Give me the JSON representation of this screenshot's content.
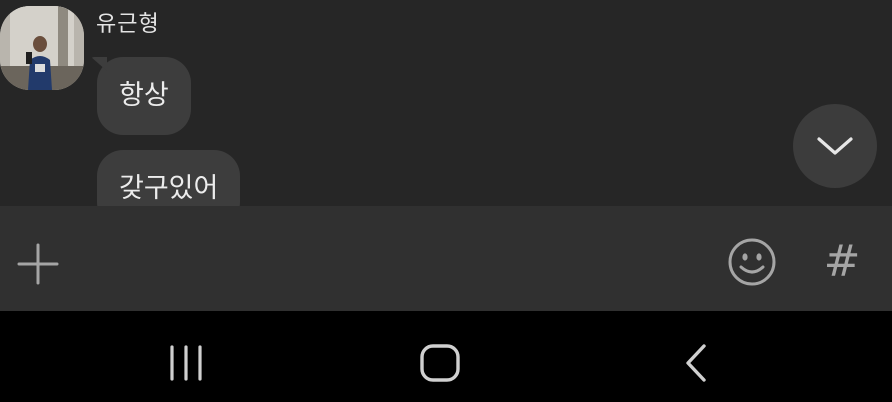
{
  "chat": {
    "sender": {
      "name": "유근형",
      "avatar_icon": "profile-photo"
    },
    "messages": [
      {
        "text": "항상"
      },
      {
        "text": "갖구있어"
      }
    ],
    "scroll_down_icon": "chevron-down-icon"
  },
  "input_bar": {
    "attach_icon": "plus-icon",
    "emoji_icon": "smiley-icon",
    "hashtag_label": "#"
  },
  "nav_bar": {
    "recents_icon": "recent-apps-icon",
    "home_icon": "home-icon",
    "back_icon": "back-icon"
  },
  "colors": {
    "chat_background": "#262626",
    "bubble": "#3d3d3d",
    "input_bar": "#303030",
    "nav_bar": "#000000",
    "icon": "#a5a5a5"
  }
}
